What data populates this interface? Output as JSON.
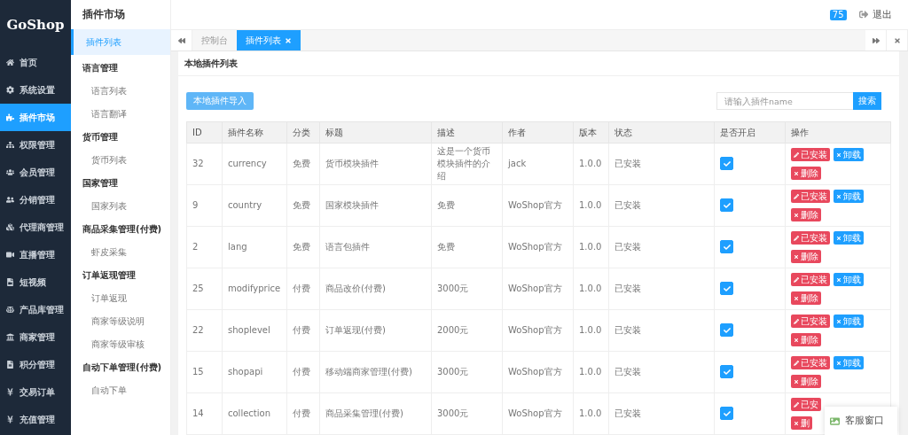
{
  "logo": "GoShop",
  "nav": [
    {
      "label": "首页",
      "selected": false
    },
    {
      "label": "系统设置",
      "selected": false
    },
    {
      "label": "插件市场",
      "selected": true
    },
    {
      "label": "权限管理",
      "selected": false
    },
    {
      "label": "会员管理",
      "selected": false
    },
    {
      "label": "分销管理",
      "selected": false
    },
    {
      "label": "代理商管理",
      "selected": false
    },
    {
      "label": "直播管理",
      "selected": false
    },
    {
      "label": "短视频",
      "selected": false
    },
    {
      "label": "产品库管理",
      "selected": false
    },
    {
      "label": "商家管理",
      "selected": false
    },
    {
      "label": "积分管理",
      "selected": false
    },
    {
      "label": "交易订单",
      "selected": false
    },
    {
      "label": "充值管理",
      "selected": false
    }
  ],
  "subnav": {
    "title": "插件市场",
    "items": [
      {
        "label": "插件列表",
        "selected": true
      },
      {
        "label": "语言管理",
        "selected": false,
        "children": [
          {
            "label": "语言列表",
            "selected": false
          },
          {
            "label": "语言翻译",
            "selected": false
          }
        ]
      },
      {
        "label": "货币管理",
        "selected": false,
        "children": [
          {
            "label": "货币列表",
            "selected": false
          }
        ]
      },
      {
        "label": "国家管理",
        "selected": false,
        "children": [
          {
            "label": "国家列表",
            "selected": false
          }
        ]
      },
      {
        "label": "商品采集管理(付费)",
        "selected": false,
        "children": [
          {
            "label": "虾皮采集",
            "selected": false
          }
        ]
      },
      {
        "label": "订单返现管理",
        "selected": false,
        "children": [
          {
            "label": "订单返现",
            "selected": false
          },
          {
            "label": "商家等级说明",
            "selected": false
          },
          {
            "label": "商家等级审核",
            "selected": false
          }
        ]
      },
      {
        "label": "自动下单管理(付费)",
        "selected": false,
        "children": [
          {
            "label": "自动下单",
            "selected": false
          }
        ]
      }
    ]
  },
  "topbar": {
    "badge": "75",
    "logout": "退出"
  },
  "tabs": [
    {
      "label": "控制台",
      "selected": false
    },
    {
      "label": "插件列表",
      "selected": true
    }
  ],
  "panel": {
    "title": "本地插件列表",
    "import_button": "本地插件导入",
    "search": {
      "placeholder": "请输入插件name",
      "button": "搜索"
    }
  },
  "table": {
    "columns": [
      "ID",
      "插件名称",
      "分类",
      "标题",
      "描述",
      "作者",
      "版本",
      "状态",
      "是否开启",
      "操作"
    ],
    "rows": [
      {
        "cells": [
          "32",
          "currency",
          "免费",
          "货币模块插件",
          "这是一个货币模块插件的介绍",
          "jack",
          "1.0.0",
          "已安装"
        ],
        "enabled": true,
        "actions": [
          {
            "label": "已安装",
            "kind": "edit"
          },
          {
            "label": "卸载",
            "kind": "uninstall"
          },
          {
            "label": "删除",
            "kind": "delete"
          }
        ]
      },
      {
        "cells": [
          "9",
          "country",
          "免费",
          "国家模块插件",
          "免费",
          "WoShop官方",
          "1.0.0",
          "已安装"
        ],
        "enabled": true,
        "actions": [
          {
            "label": "已安装",
            "kind": "edit"
          },
          {
            "label": "卸载",
            "kind": "uninstall"
          },
          {
            "label": "删除",
            "kind": "delete"
          }
        ]
      },
      {
        "cells": [
          "2",
          "lang",
          "免费",
          "语言包插件",
          "免费",
          "WoShop官方",
          "1.0.0",
          "已安装"
        ],
        "enabled": true,
        "actions": [
          {
            "label": "已安装",
            "kind": "edit"
          },
          {
            "label": "卸载",
            "kind": "uninstall"
          },
          {
            "label": "删除",
            "kind": "delete"
          }
        ]
      },
      {
        "cells": [
          "25",
          "modifyprice",
          "付费",
          "商品改价(付费)",
          "3000元",
          "WoShop官方",
          "1.0.0",
          "已安装"
        ],
        "enabled": true,
        "actions": [
          {
            "label": "已安装",
            "kind": "edit"
          },
          {
            "label": "卸载",
            "kind": "uninstall"
          },
          {
            "label": "删除",
            "kind": "delete"
          }
        ]
      },
      {
        "cells": [
          "22",
          "shoplevel",
          "付费",
          "订单返现(付费)",
          "2000元",
          "WoShop官方",
          "1.0.0",
          "已安装"
        ],
        "enabled": true,
        "actions": [
          {
            "label": "已安装",
            "kind": "edit"
          },
          {
            "label": "卸载",
            "kind": "uninstall"
          },
          {
            "label": "删除",
            "kind": "delete"
          }
        ]
      },
      {
        "cells": [
          "15",
          "shopapi",
          "付费",
          "移动端商家管理(付费)",
          "3000元",
          "WoShop官方",
          "1.0.0",
          "已安装"
        ],
        "enabled": true,
        "actions": [
          {
            "label": "已安装",
            "kind": "edit"
          },
          {
            "label": "卸载",
            "kind": "uninstall"
          },
          {
            "label": "删除",
            "kind": "delete"
          }
        ]
      },
      {
        "cells": [
          "14",
          "collection",
          "付费",
          "商品采集管理(付费)",
          "3000元",
          "WoShop官方",
          "1.0.0",
          "已安装"
        ],
        "enabled": true,
        "actions": [
          {
            "label": "已安",
            "kind": "edit"
          },
          {
            "label": "删",
            "kind": "delete"
          }
        ]
      }
    ]
  },
  "chat_widget": {
    "label": "客服窗口"
  }
}
